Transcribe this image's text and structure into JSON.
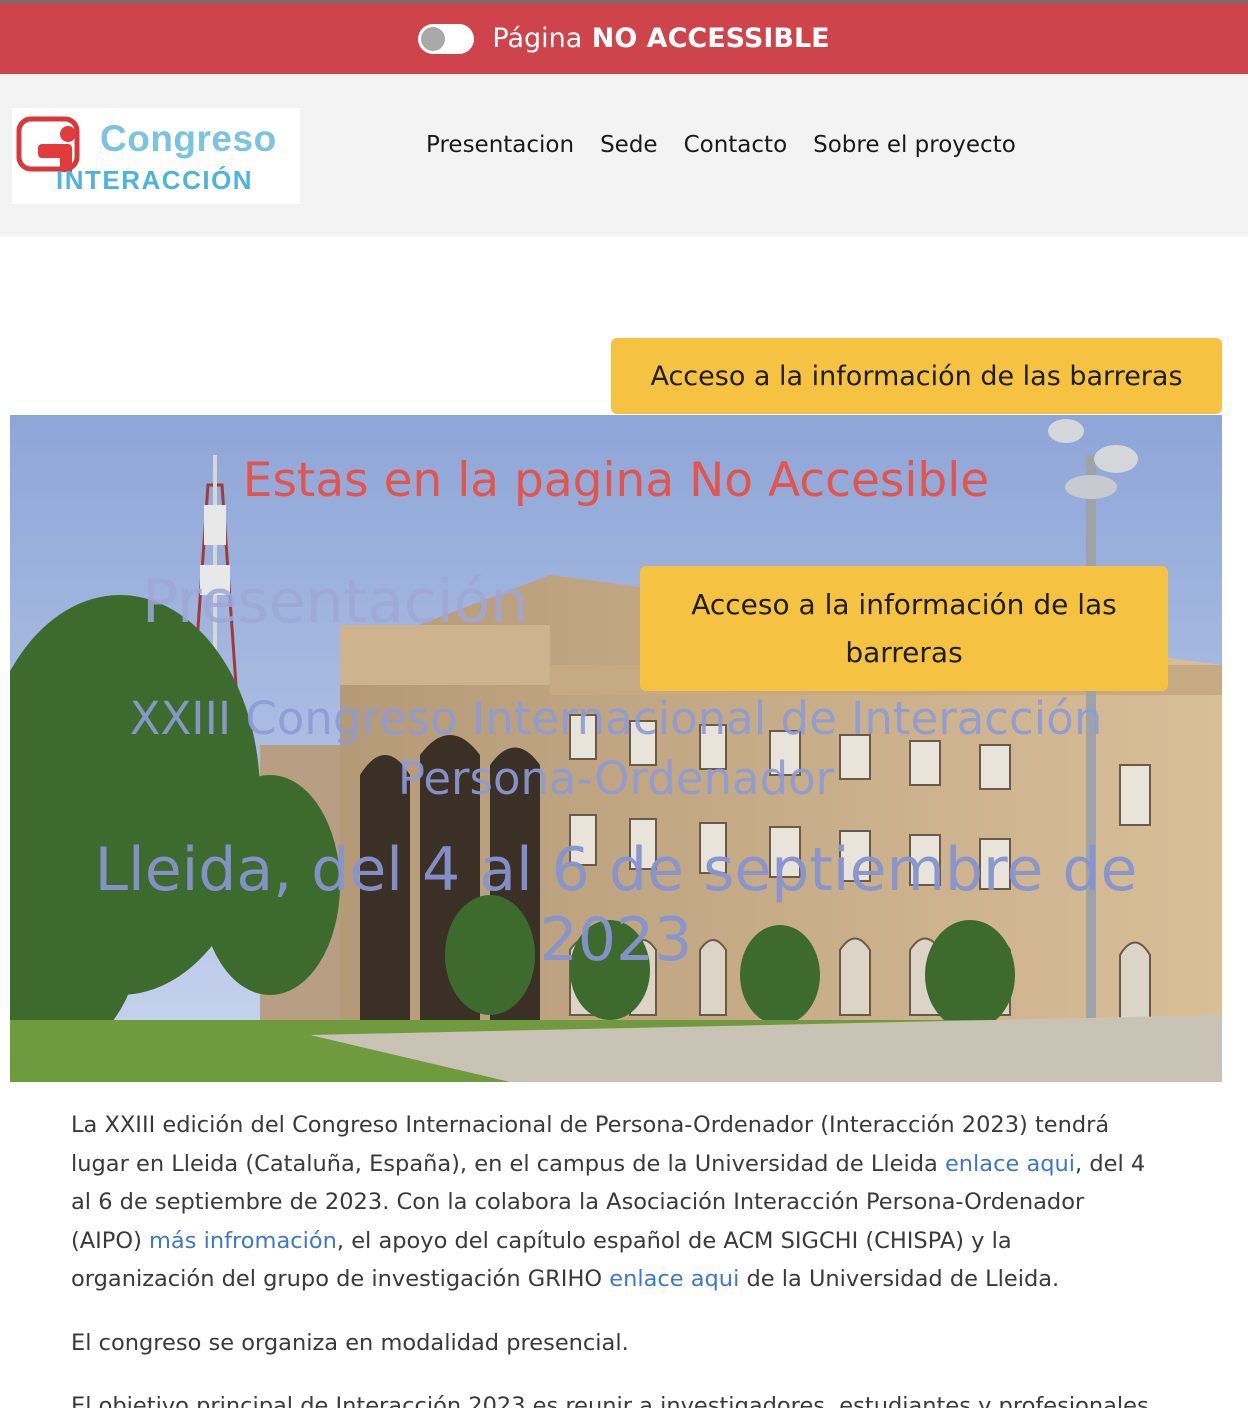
{
  "topbar": {
    "label_prefix": "Página",
    "label_strong": "NO ACCESSIBLE",
    "toggle_state": "off"
  },
  "header": {
    "logo": {
      "word1": "Congreso",
      "word2": "NTERACCIÓN",
      "word2_initial": "I"
    },
    "nav": [
      {
        "label": "Presentacion"
      },
      {
        "label": "Sede"
      },
      {
        "label": "Contacto"
      },
      {
        "label": "Sobre el proyecto"
      }
    ]
  },
  "barriers_button_top": "Acceso a la información de las barreras",
  "hero": {
    "warning": "Estas en la pagina No Accesible",
    "title": "Presentación",
    "subtitle": "XXIII Congreso Internacional de Interacción Persona-Ordenador",
    "date": "Lleida, del 4 al 6 de septiembre de 2023",
    "barriers_button": "Acceso a la información de las barreras"
  },
  "content": {
    "p1": {
      "t1": "La XXIII edición del Congreso Internacional de Persona-Ordenador (Interacción 2023) tendrá lugar en Lleida (Cataluña, España), en el campus de la Universidad de Lleida ",
      "link1": "enlace aqui",
      "t2": ", del 4 al 6 de septiembre de 2023. Con la colabora la Asociación Interacción Persona-Ordenador (AIPO) ",
      "link2": "más infromación",
      "t3": ", el apoyo del capítulo español de ACM SIGCHI (CHISPA) y la organización del grupo de investigación GRIHO ",
      "link3": "enlace aqui",
      "t4": " de la Universidad de Lleida."
    },
    "p2": "El congreso se organiza en modalidad presencial.",
    "p3": "El objetivo principal de Interacción 2023 es reunir a investigadores, estudiantes y profesionales"
  },
  "colors": {
    "topbar_red": "#cf434a",
    "barrier_yellow": "#f5c242",
    "link_blue": "#3f78c9",
    "warning_red": "#e3554c"
  }
}
